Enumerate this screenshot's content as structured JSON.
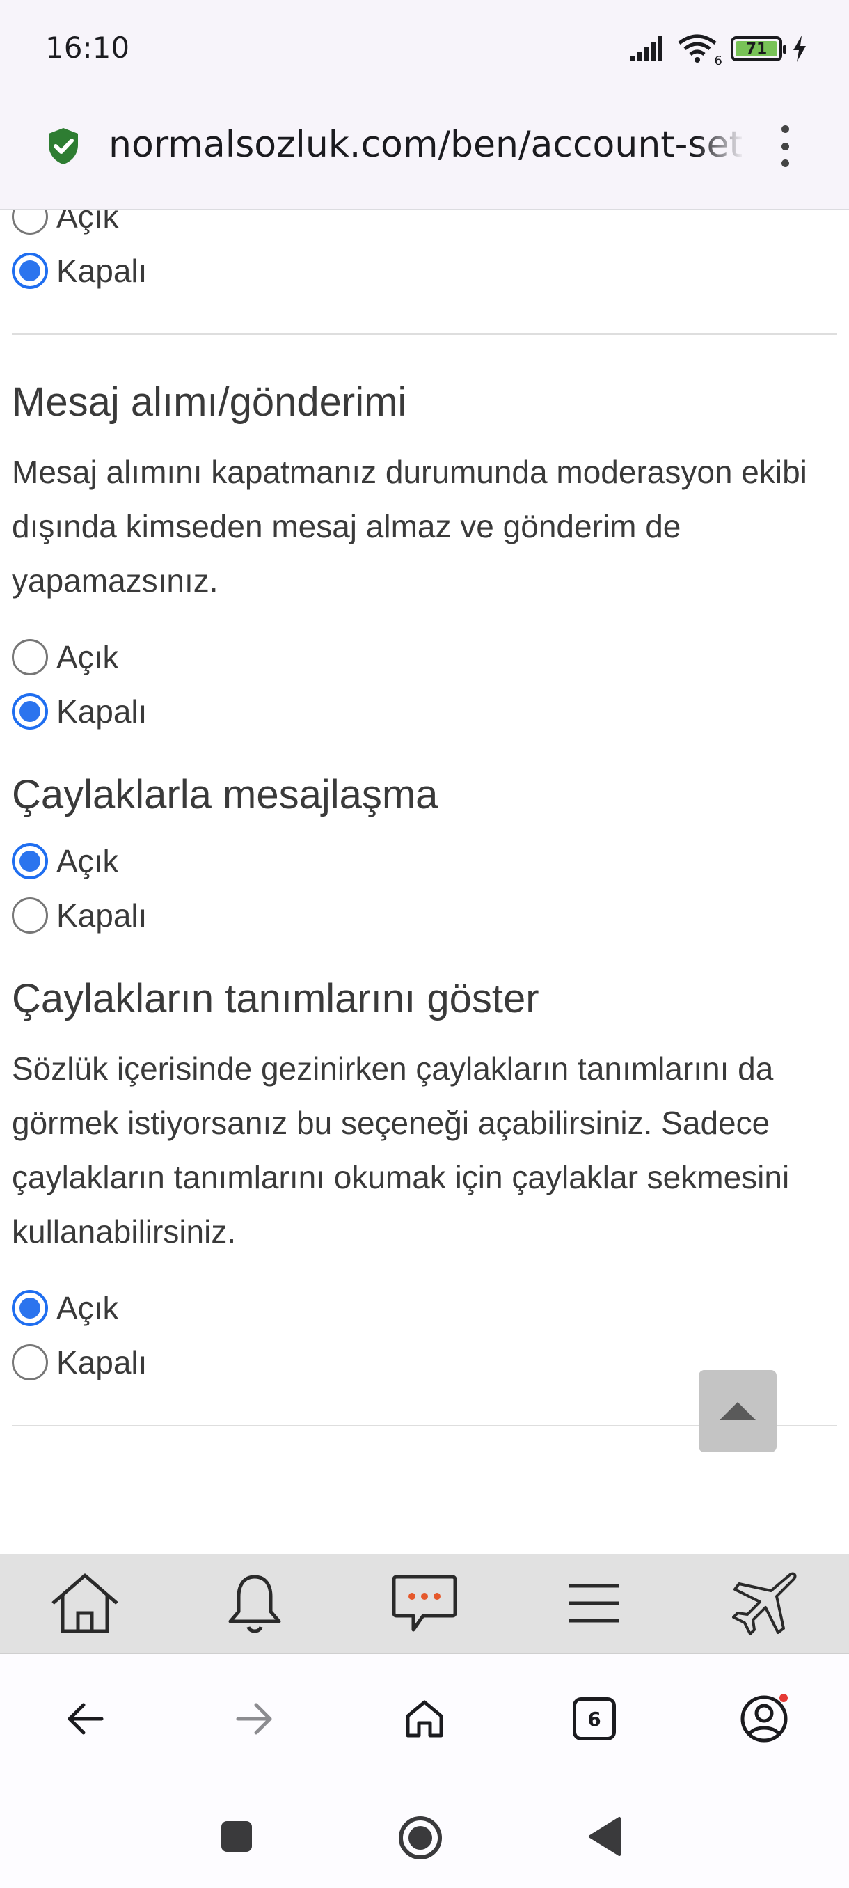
{
  "status": {
    "time": "16:10",
    "battery": "71",
    "wifi_sub": "6"
  },
  "browser": {
    "url": "normalsozluk.com/ben/account-settings",
    "tab_count": "6"
  },
  "settings": {
    "prev_options": [
      {
        "label": "Açık",
        "checked": false
      },
      {
        "label": "Kapalı",
        "checked": true
      }
    ],
    "messaging": {
      "title": "Mesaj alımı/gönderimi",
      "description": "Mesaj alımını kapatmanız durumunda moderasyon ekibi dışında kimseden mesaj almaz ve gönderim de yapamazsınız.",
      "options": [
        {
          "label": "Açık",
          "checked": false
        },
        {
          "label": "Kapalı",
          "checked": true
        }
      ]
    },
    "novice_messaging": {
      "title": "Çaylaklarla mesajlaşma",
      "options": [
        {
          "label": "Açık",
          "checked": true
        },
        {
          "label": "Kapalı",
          "checked": false
        }
      ]
    },
    "novice_entries": {
      "title": "Çaylakların tanımlarını göster",
      "description": "Sözlük içerisinde gezinirken çaylakların tanımlarını da görmek istiyorsanız bu seçeneği açabilirsiniz. Sadece çaylakların tanımlarını okumak için çaylaklar sekmesini kullanabilirsiniz.",
      "options": [
        {
          "label": "Açık",
          "checked": true
        },
        {
          "label": "Kapalı",
          "checked": false
        }
      ]
    }
  },
  "site_nav": {
    "icons": [
      "home-icon",
      "bell-icon",
      "messages-icon",
      "menu-icon",
      "airplane-icon"
    ]
  },
  "colors": {
    "accent": "#2b74ee",
    "shield": "#2e7d32",
    "notification_dot": "#e53935"
  }
}
